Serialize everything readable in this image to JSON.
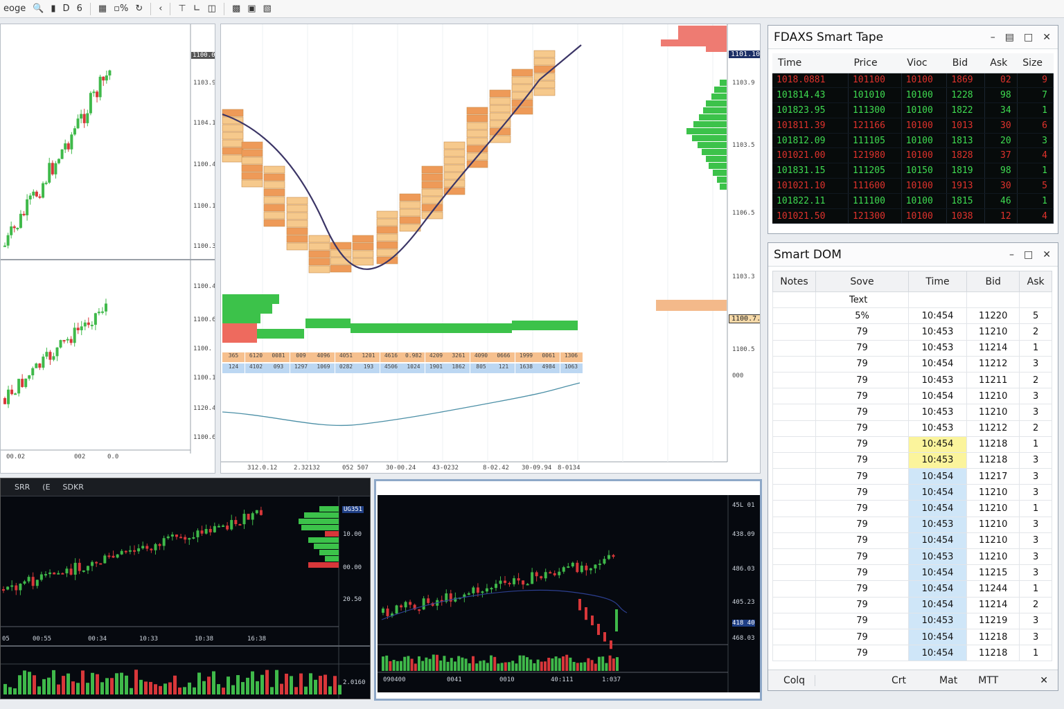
{
  "toolbar": {
    "items": [
      "eoge",
      "6",
      "%"
    ]
  },
  "left_chart": {
    "price_labels": [
      "1103.9",
      "1104.1",
      "1100.4",
      "1100.1",
      "1100.3",
      "1100.4",
      "1100.6",
      "1100.",
      "1100.1",
      "1120.4",
      "1100.6"
    ],
    "price_tag": "1100.0",
    "time_labels": [
      "00.02",
      "002",
      "0.0"
    ]
  },
  "center_chart": {
    "price_tag_top": "1101.10",
    "price_tag_mid": "1100.7.7",
    "price_labels": [
      "1103.9",
      "1103.5",
      "1106.5",
      "1103.3",
      "1100.5",
      "000"
    ],
    "time_labels": [
      "312.0.12",
      "2.32132",
      "052 507",
      "30-00.24",
      "43-0232",
      "8-02.42",
      "30-09.94",
      "8-0134"
    ],
    "delta_row1": [
      "365",
      "6120",
      "0081",
      "009",
      "4096",
      "4051",
      "1201",
      "4616",
      "0.982",
      "4209",
      "3261",
      "4090",
      "0666",
      "1999",
      "0061",
      "1306"
    ],
    "delta_row2": [
      "124",
      "4102",
      "093",
      "1297",
      "1069",
      "0282",
      "193",
      "4506",
      "1024",
      "1901",
      "1862",
      "805",
      "121",
      "1638",
      "4984",
      "1063"
    ]
  },
  "bottom_left_chart": {
    "header": [
      "SRR",
      "(E",
      "SDKR"
    ],
    "price_tag": "UG351",
    "price_labels": [
      "10.00",
      "00.00",
      "20.50",
      "2.0160"
    ],
    "time_labels": [
      "05",
      "00:55",
      "00:34",
      "10:33",
      "10:38",
      "16:38"
    ]
  },
  "bottom_right_chart": {
    "price_labels": [
      "45L 01",
      "438.09",
      "486.03",
      "405.23",
      "418 40",
      "468.03"
    ],
    "time_labels": [
      "090400",
      "0041",
      "0010",
      "40:111",
      "1:037"
    ]
  },
  "smart_tape": {
    "title": "FDAXS Smart Tape",
    "columns": [
      "Time",
      "Price",
      "Vioc",
      "Bid",
      "Ask",
      "Size"
    ],
    "rows": [
      {
        "time": "1018.0881",
        "price": "101100",
        "vioc": "10100",
        "bid": "1869",
        "ask": "02",
        "size": "9",
        "side": "red"
      },
      {
        "time": "101814.43",
        "price": "101010",
        "vioc": "10100",
        "bid": "1228",
        "ask": "98",
        "size": "7",
        "side": "green"
      },
      {
        "time": "101823.95",
        "price": "111300",
        "vioc": "10100",
        "bid": "1822",
        "ask": "34",
        "size": "1",
        "side": "green"
      },
      {
        "time": "101811.39",
        "price": "121166",
        "vioc": "10100",
        "bid": "1013",
        "ask": "30",
        "size": "6",
        "side": "red"
      },
      {
        "time": "101812.09",
        "price": "111105",
        "vioc": "10100",
        "bid": "1813",
        "ask": "20",
        "size": "3",
        "side": "green"
      },
      {
        "time": "101021.00",
        "price": "121980",
        "vioc": "10100",
        "bid": "1828",
        "ask": "37",
        "size": "4",
        "side": "red"
      },
      {
        "time": "101831.15",
        "price": "111205",
        "vioc": "10150",
        "bid": "1819",
        "ask": "98",
        "size": "1",
        "side": "green"
      },
      {
        "time": "101021.10",
        "price": "111600",
        "vioc": "10100",
        "bid": "1913",
        "ask": "30",
        "size": "5",
        "side": "red"
      },
      {
        "time": "101822.11",
        "price": "111100",
        "vioc": "10100",
        "bid": "1815",
        "ask": "46",
        "size": "1",
        "side": "green"
      },
      {
        "time": "101021.50",
        "price": "121300",
        "vioc": "10100",
        "bid": "1038",
        "ask": "12",
        "size": "4",
        "side": "red"
      }
    ]
  },
  "smart_dom": {
    "title": "Smart DOM",
    "columns": [
      "Notes",
      "Sove",
      "Time",
      "Bid",
      "Ask"
    ],
    "text_row": "Text",
    "rows": [
      {
        "sove": "5%",
        "time": "10:454",
        "bid": "11220",
        "ask": "5",
        "hl": ""
      },
      {
        "sove": "79",
        "time": "10:453",
        "bid": "11210",
        "ask": "2",
        "hl": ""
      },
      {
        "sove": "79",
        "time": "10:453",
        "bid": "11214",
        "ask": "1",
        "hl": ""
      },
      {
        "sove": "79",
        "time": "10:454",
        "bid": "11212",
        "ask": "3",
        "hl": ""
      },
      {
        "sove": "79",
        "time": "10:453",
        "bid": "11211",
        "ask": "2",
        "hl": ""
      },
      {
        "sove": "79",
        "time": "10:454",
        "bid": "11210",
        "ask": "3",
        "hl": ""
      },
      {
        "sove": "79",
        "time": "10:453",
        "bid": "11210",
        "ask": "3",
        "hl": ""
      },
      {
        "sove": "79",
        "time": "10:453",
        "bid": "11212",
        "ask": "2",
        "hl": ""
      },
      {
        "sove": "79",
        "time": "10:454",
        "bid": "11218",
        "ask": "1",
        "hl": "yellow"
      },
      {
        "sove": "79",
        "time": "10:453",
        "bid": "11218",
        "ask": "3",
        "hl": "yellow"
      },
      {
        "sove": "79",
        "time": "10:454",
        "bid": "11217",
        "ask": "3",
        "hl": "blue"
      },
      {
        "sove": "79",
        "time": "10:454",
        "bid": "11210",
        "ask": "3",
        "hl": "blue"
      },
      {
        "sove": "79",
        "time": "10:454",
        "bid": "11210",
        "ask": "1",
        "hl": "blue"
      },
      {
        "sove": "79",
        "time": "10:453",
        "bid": "11210",
        "ask": "3",
        "hl": "blue"
      },
      {
        "sove": "79",
        "time": "10:454",
        "bid": "11210",
        "ask": "3",
        "hl": "blue"
      },
      {
        "sove": "79",
        "time": "10:453",
        "bid": "11210",
        "ask": "3",
        "hl": "blue"
      },
      {
        "sove": "79",
        "time": "10:454",
        "bid": "11215",
        "ask": "3",
        "hl": "blue"
      },
      {
        "sove": "79",
        "time": "10:454",
        "bid": "11244",
        "ask": "1",
        "hl": "blue"
      },
      {
        "sove": "79",
        "time": "10:454",
        "bid": "11214",
        "ask": "2",
        "hl": "blue"
      },
      {
        "sove": "79",
        "time": "10:453",
        "bid": "11219",
        "ask": "3",
        "hl": "blue"
      },
      {
        "sove": "79",
        "time": "10:454",
        "bid": "11218",
        "ask": "3",
        "hl": "blue"
      },
      {
        "sove": "79",
        "time": "10:454",
        "bid": "11218",
        "ask": "1",
        "hl": "blue"
      }
    ],
    "footer": [
      "Colq",
      "Crt",
      "Mat",
      "MTT"
    ]
  },
  "colors": {
    "up": "#3fb94a",
    "down": "#d8373a",
    "footprint_orange": "#f2b777",
    "profile_green": "#3cc24a",
    "profile_red": "#ee7b72",
    "poc_line": "#3b3566"
  }
}
